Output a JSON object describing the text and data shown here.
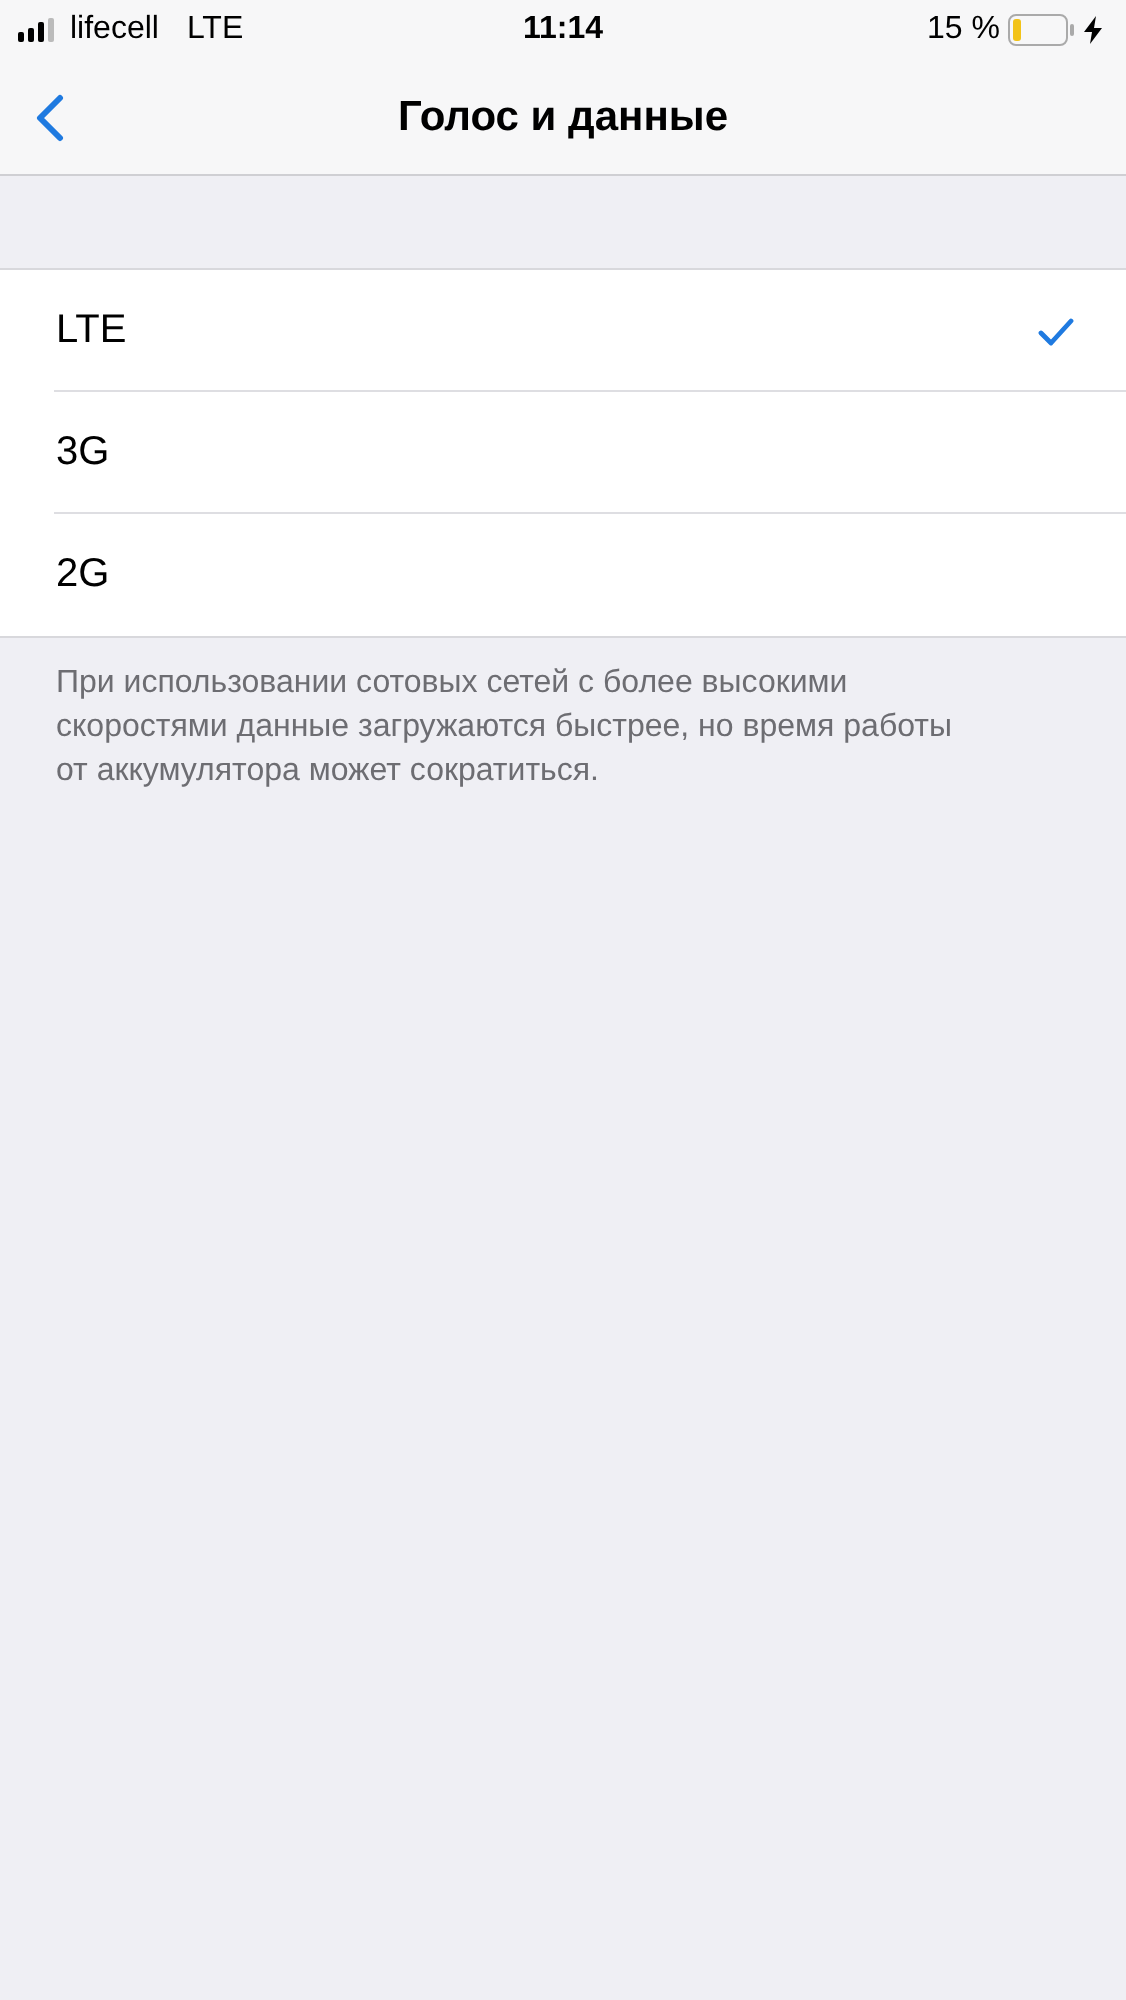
{
  "status_bar": {
    "carrier": "lifecell",
    "network": "LTE",
    "time": "11:14",
    "battery": "15 %"
  },
  "nav_bar": {
    "title": "Голос и данные"
  },
  "options": [
    {
      "label": "LTE",
      "selected": true
    },
    {
      "label": "3G",
      "selected": false
    },
    {
      "label": "2G",
      "selected": false
    }
  ],
  "footer": "При использовании сотовых сетей с более высокими скоростями данные загружаются быстрее, но время работы от аккумулятора может сократиться."
}
